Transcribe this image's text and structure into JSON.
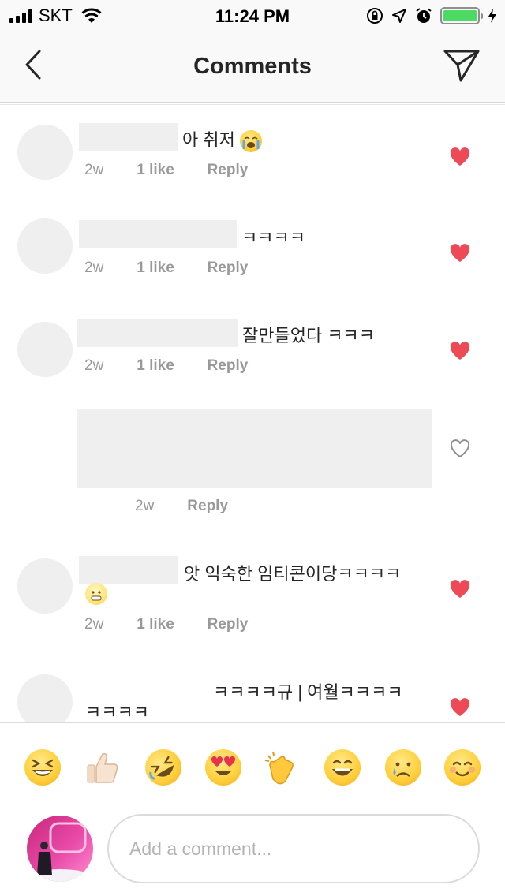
{
  "status_bar": {
    "carrier": "SKT",
    "time": "11:24 PM",
    "battery_level": 1.0,
    "battery_color": "#4cd964"
  },
  "nav": {
    "title": "Comments",
    "back_icon": "chevron-left-icon",
    "send_icon": "paper-plane-icon"
  },
  "comments": [
    {
      "text": "아 취저",
      "ago": "2w",
      "likes": "1 like",
      "reply": "Reply",
      "liked": true
    },
    {
      "text": "ㅋㅋㅋㅋ",
      "ago": "2w",
      "likes": "1 like",
      "reply": "Reply",
      "liked": true
    },
    {
      "text": "잘만들었다 ㅋㅋㅋ",
      "ago": "2w",
      "likes": "1 like",
      "reply": "Reply",
      "liked": true
    },
    {
      "text": "",
      "ago": "2w",
      "likes": "",
      "reply": "Reply",
      "liked": false
    },
    {
      "text": "앗 익숙한 임티콘이당ㅋㅋㅋㅋ",
      "ago": "2w",
      "likes": "1 like",
      "reply": "Reply",
      "liked": true
    },
    {
      "text": "ㅋㅋㅋㅋ규 | 여월ㅋㅋㅋㅋ",
      "text2": "ㅋㅋㅋㅋ",
      "liked": true
    }
  ],
  "emoji_bar": [
    "laughing-squint-emoji",
    "thumbs-up-emoji",
    "rolling-laughing-emoji",
    "heart-eyes-emoji",
    "clapping-hands-emoji",
    "grinning-emoji",
    "crying-emoji",
    "smiling-blush-emoji"
  ],
  "composer": {
    "placeholder": "Add a comment..."
  },
  "colors": {
    "liked_heart": "#ed4956",
    "meta_text": "#999999",
    "placeholder_gray": "#efefef"
  }
}
